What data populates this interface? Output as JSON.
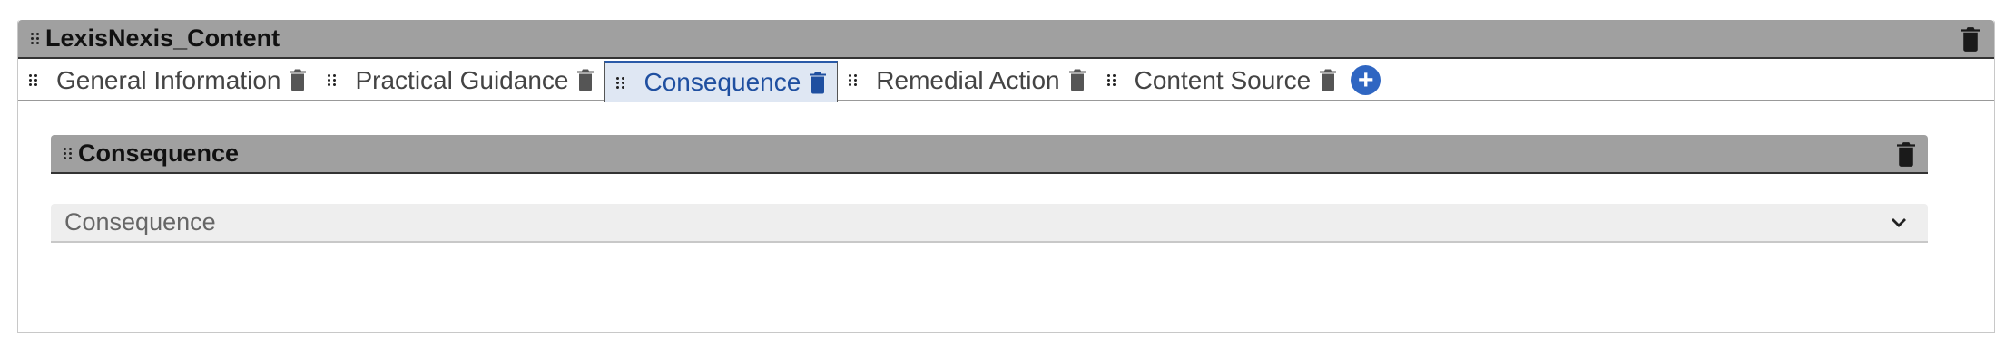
{
  "section": {
    "title": "LexisNexis_Content"
  },
  "tabs": [
    {
      "label": "General Information",
      "active": false
    },
    {
      "label": "Practical Guidance",
      "active": false
    },
    {
      "label": "Consequence",
      "active": true
    },
    {
      "label": "Remedial Action",
      "active": false
    },
    {
      "label": "Content Source",
      "active": false
    }
  ],
  "subsection": {
    "title": "Consequence"
  },
  "dropdown": {
    "value": "Consequence"
  },
  "colors": {
    "accent": "#2f66c2",
    "header_bg": "#a0a0a0",
    "active_tab_bg": "#dfe7f3"
  },
  "icons": {
    "drag": "drag-handle-icon",
    "delete": "trash-icon",
    "add": "plus-circle-icon",
    "expand": "chevron-down-icon"
  }
}
